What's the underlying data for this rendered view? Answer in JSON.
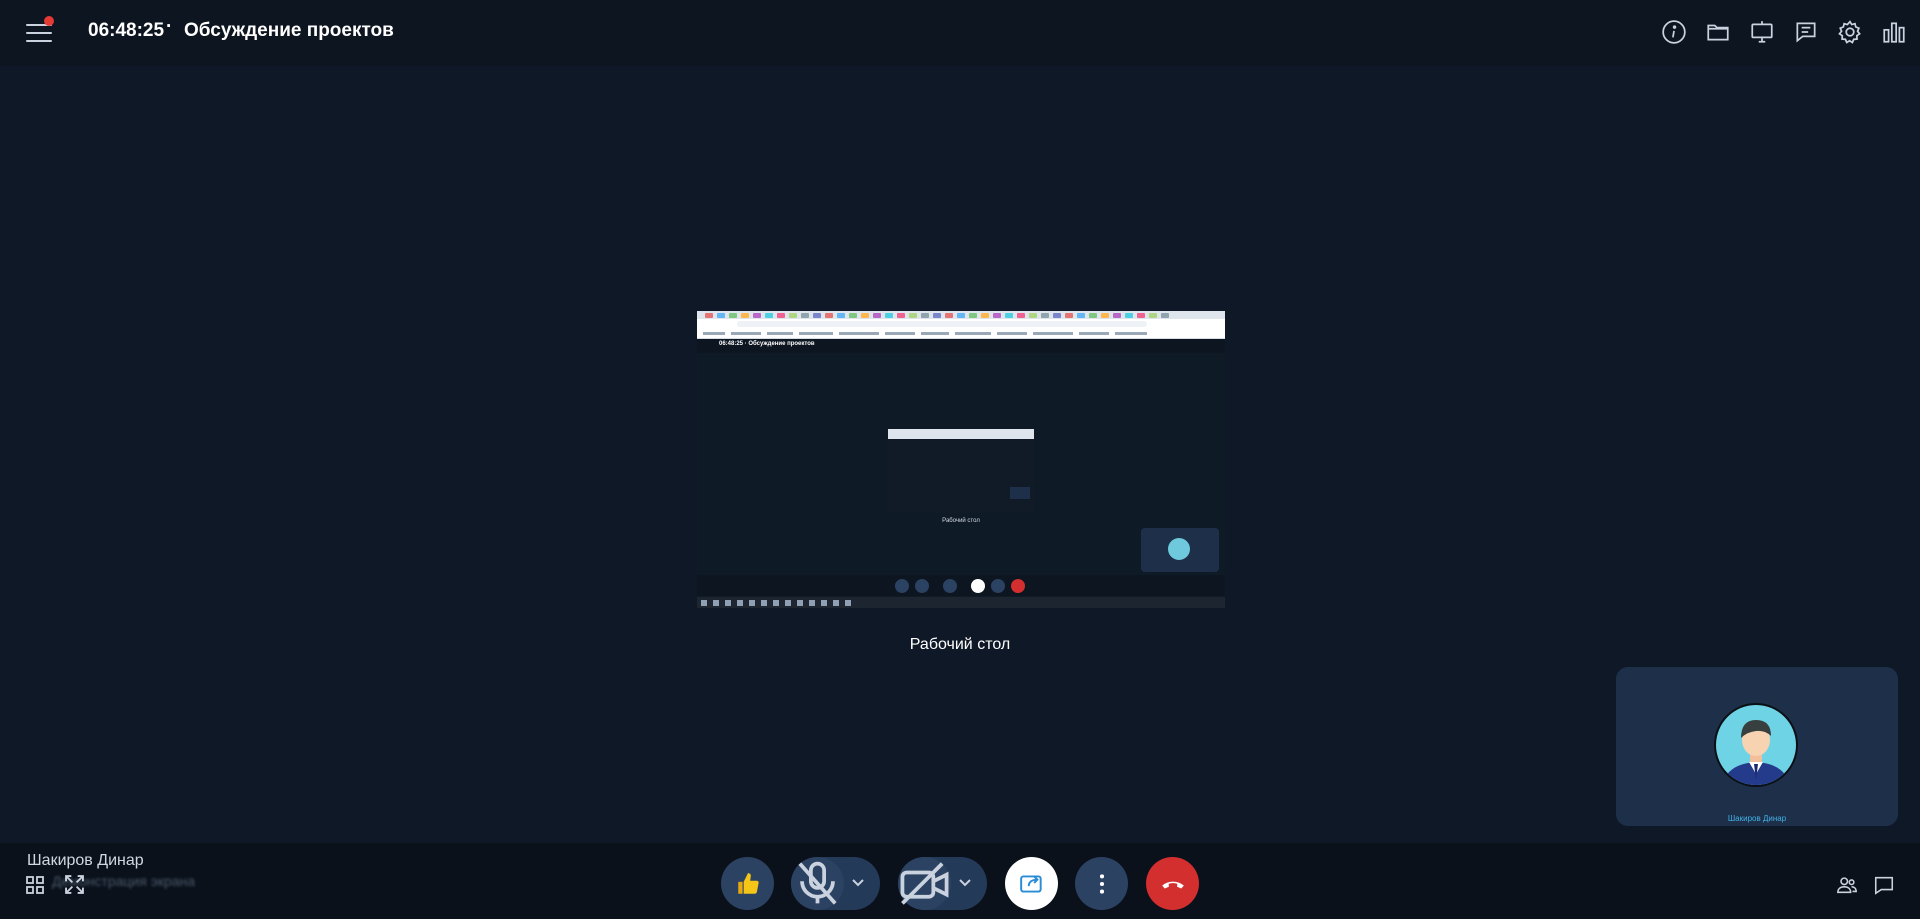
{
  "header": {
    "time": "06:48:25",
    "separator": "·",
    "title": "Обсуждение проектов",
    "menu_icon": "hamburger-menu-icon",
    "icons": [
      "info-icon",
      "folder-icon",
      "screen-share-icon",
      "chat-icon",
      "settings-icon",
      "stats-icon"
    ]
  },
  "shared_screen": {
    "caption": "Рабочий стол",
    "mini_title": "06:48:25 · Обсуждение проектов",
    "mini_caption": "Рабочий стол"
  },
  "self_view": {
    "name": "Шакиров Динар"
  },
  "presenter": {
    "name": "Шакиров Динар",
    "subtitle": "Демонстрация экрана"
  },
  "controls": [
    "reaction-icon",
    "mic-off-icon",
    "camera-off-icon",
    "share-screen-icon",
    "more-icon",
    "hangup-icon"
  ],
  "colors": {
    "background": "#0f1826",
    "tile": "#1e3049",
    "control": "#2c4263",
    "hangup": "#d32f2f",
    "accent_dot": "#e53935",
    "thumb": "#f5c518"
  }
}
